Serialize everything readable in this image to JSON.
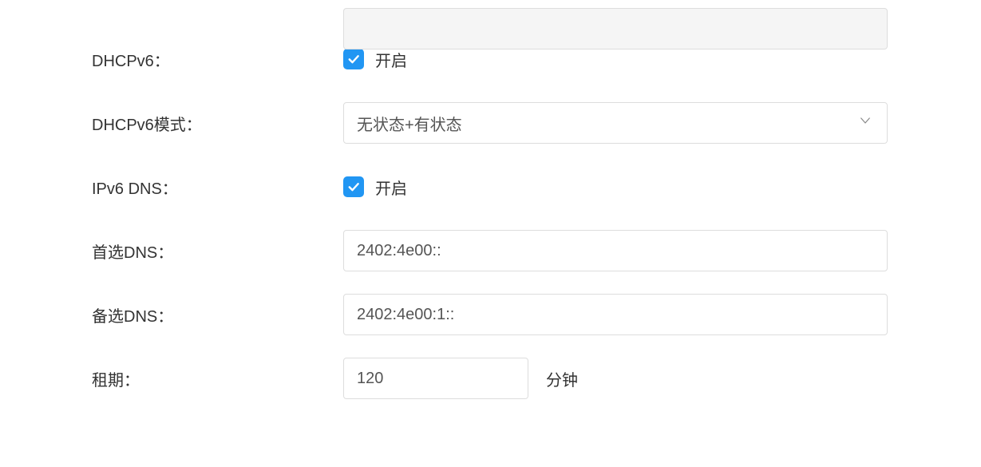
{
  "form": {
    "dhcpv6": {
      "label": "DHCPv6：",
      "checked": true,
      "checkbox_label": "开启"
    },
    "dhcpv6_mode": {
      "label": "DHCPv6模式：",
      "value": "无状态+有状态"
    },
    "ipv6_dns": {
      "label": "IPv6 DNS：",
      "checked": true,
      "checkbox_label": "开启"
    },
    "primary_dns": {
      "label": "首选DNS：",
      "value": "2402:4e00::"
    },
    "secondary_dns": {
      "label": "备选DNS：",
      "value": "2402:4e00:1::"
    },
    "lease": {
      "label": "租期：",
      "value": "120",
      "unit": "分钟"
    }
  }
}
